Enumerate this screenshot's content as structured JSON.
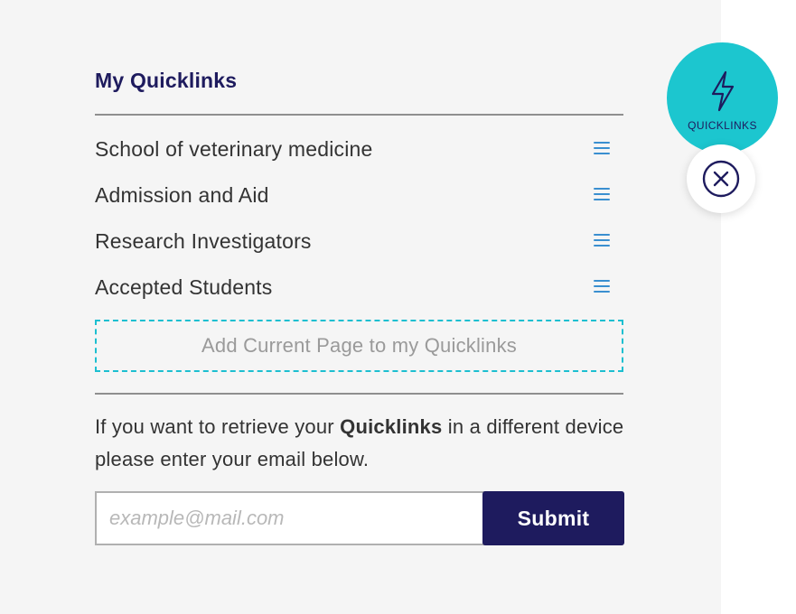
{
  "quicklinks": {
    "title": "My Quicklinks",
    "items": [
      {
        "label": "School of veterinary medicine"
      },
      {
        "label": "Admission and Aid"
      },
      {
        "label": "Research Investigators"
      },
      {
        "label": "Accepted Students"
      }
    ],
    "add_current_label": "Add Current Page to my Quicklinks"
  },
  "retrieve": {
    "text_before": "If you want to retrieve your ",
    "text_bold": "Quicklinks",
    "text_after": " in a different device please enter your email below.",
    "email_placeholder": "example@mail.com",
    "email_value": "",
    "submit_label": "Submit"
  },
  "fab": {
    "label": "QUICKLINKS",
    "icon": "lightning-bolt-icon",
    "close_icon": "close-circle-icon"
  },
  "colors": {
    "panel_bg": "#f5f5f5",
    "brand_navy": "#1e1b5e",
    "accent_teal": "#1cc6cf",
    "drag_handle_blue": "#3a8fd0"
  }
}
